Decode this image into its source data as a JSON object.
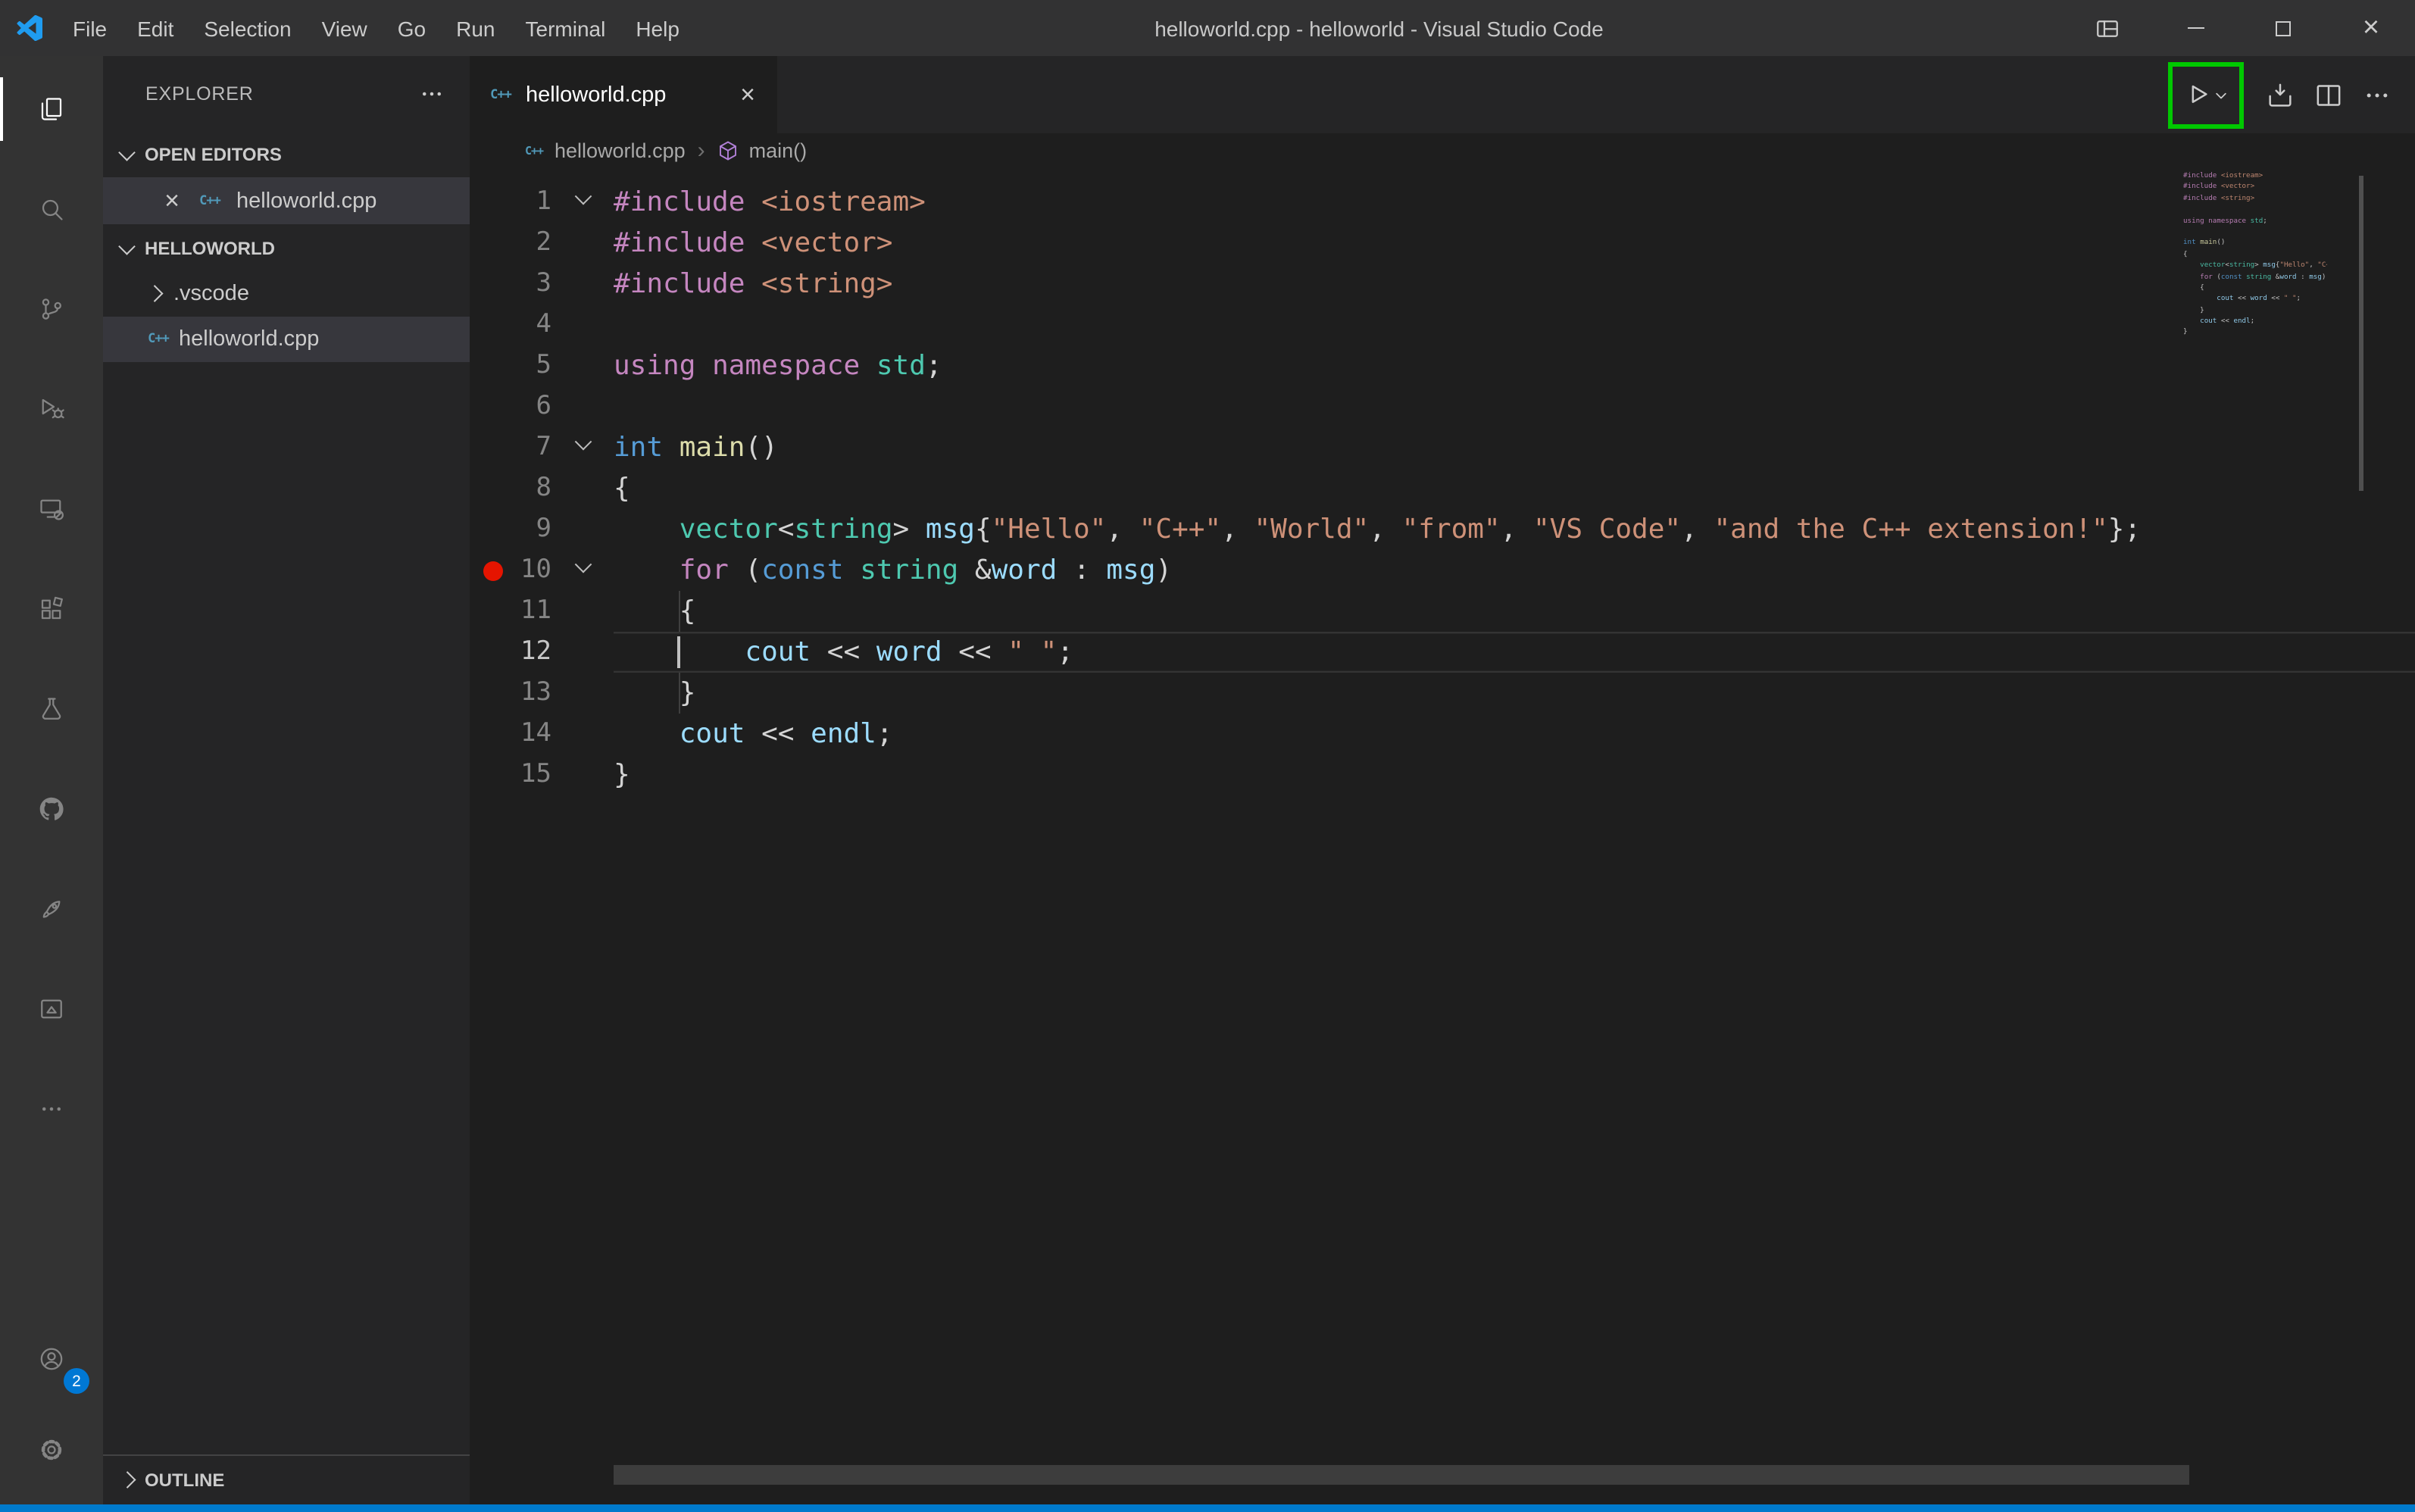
{
  "window": {
    "title": "helloworld.cpp - helloworld - Visual Studio Code",
    "menus": [
      "File",
      "Edit",
      "Selection",
      "View",
      "Go",
      "Run",
      "Terminal",
      "Help"
    ],
    "controls": [
      "layout",
      "minimize",
      "maximize",
      "close"
    ]
  },
  "activity_bar": {
    "top": [
      {
        "icon": "explorer",
        "active": true
      },
      {
        "icon": "search"
      },
      {
        "icon": "source-control"
      },
      {
        "icon": "run-and-debug"
      },
      {
        "icon": "remote-explorer"
      },
      {
        "icon": "extensions"
      },
      {
        "icon": "testing"
      },
      {
        "icon": "github"
      },
      {
        "icon": "rocket"
      },
      {
        "icon": "live-preview"
      },
      {
        "icon": "more"
      }
    ],
    "bottom": [
      {
        "icon": "accounts",
        "badge": "2"
      },
      {
        "icon": "settings"
      }
    ]
  },
  "explorer": {
    "title": "EXPLORER",
    "open_editors": {
      "label": "OPEN EDITORS",
      "items": [
        {
          "name": "helloworld.cpp",
          "icon": "cpp",
          "active": true
        }
      ]
    },
    "workspace": {
      "label": "HELLOWORLD",
      "items": [
        {
          "name": ".vscode",
          "type": "folder"
        },
        {
          "name": "helloworld.cpp",
          "type": "file",
          "icon": "cpp",
          "selected": true
        }
      ]
    },
    "outline": {
      "label": "OUTLINE"
    }
  },
  "editor": {
    "tab": {
      "label": "helloworld.cpp",
      "icon": "cpp"
    },
    "breadcrumbs": {
      "file": "helloworld.cpp",
      "symbol": "main()"
    },
    "code": {
      "language": "cpp",
      "breakpoint_line": 10,
      "current_line": 12,
      "lines": [
        {
          "n": 1,
          "fold": true,
          "t": [
            [
              "kw",
              "#include"
            ],
            [
              "pl",
              " "
            ],
            [
              "str",
              "<iostream>"
            ]
          ]
        },
        {
          "n": 2,
          "t": [
            [
              "kw",
              "#include"
            ],
            [
              "pl",
              " "
            ],
            [
              "str",
              "<vector>"
            ]
          ]
        },
        {
          "n": 3,
          "t": [
            [
              "kw",
              "#include"
            ],
            [
              "pl",
              " "
            ],
            [
              "str",
              "<string>"
            ]
          ]
        },
        {
          "n": 4,
          "t": []
        },
        {
          "n": 5,
          "t": [
            [
              "kw",
              "using"
            ],
            [
              "pl",
              " "
            ],
            [
              "kw",
              "namespace"
            ],
            [
              "pl",
              " "
            ],
            [
              "type",
              "std"
            ],
            [
              "pl",
              ";"
            ]
          ]
        },
        {
          "n": 6,
          "t": []
        },
        {
          "n": 7,
          "fold": true,
          "t": [
            [
              "kw2",
              "int"
            ],
            [
              "pl",
              " "
            ],
            [
              "fn",
              "main"
            ],
            [
              "pl",
              "()"
            ]
          ]
        },
        {
          "n": 8,
          "t": [
            [
              "pl",
              "{"
            ]
          ]
        },
        {
          "n": 9,
          "t": [
            [
              "pl",
              "    "
            ],
            [
              "type",
              "vector"
            ],
            [
              "pl",
              "<"
            ],
            [
              "type",
              "string"
            ],
            [
              "pl",
              "> "
            ],
            [
              "var",
              "msg"
            ],
            [
              "pl",
              "{"
            ],
            [
              "str",
              "\"Hello\""
            ],
            [
              "pl",
              ", "
            ],
            [
              "str",
              "\"C++\""
            ],
            [
              "pl",
              ", "
            ],
            [
              "str",
              "\"World\""
            ],
            [
              "pl",
              ", "
            ],
            [
              "str",
              "\"from\""
            ],
            [
              "pl",
              ", "
            ],
            [
              "str",
              "\"VS Code\""
            ],
            [
              "pl",
              ", "
            ],
            [
              "str",
              "\"and the C++ extension!\""
            ],
            [
              "pl",
              "};"
            ]
          ]
        },
        {
          "n": 10,
          "fold": true,
          "bp": true,
          "t": [
            [
              "pl",
              "    "
            ],
            [
              "kw",
              "for"
            ],
            [
              "pl",
              " ("
            ],
            [
              "kw2",
              "const"
            ],
            [
              "pl",
              " "
            ],
            [
              "type",
              "string"
            ],
            [
              "pl",
              " &"
            ],
            [
              "var",
              "word"
            ],
            [
              "pl",
              " : "
            ],
            [
              "var",
              "msg"
            ],
            [
              "pl",
              ")"
            ]
          ]
        },
        {
          "n": 11,
          "g": true,
          "t": [
            [
              "pl",
              "    {"
            ]
          ]
        },
        {
          "n": 12,
          "cur": true,
          "cursor": true,
          "t": [
            [
              "pl",
              "        "
            ],
            [
              "var",
              "cout"
            ],
            [
              "pl",
              " << "
            ],
            [
              "var",
              "word"
            ],
            [
              "pl",
              " << "
            ],
            [
              "str",
              "\" \""
            ],
            [
              "pl",
              ";"
            ]
          ]
        },
        {
          "n": 13,
          "g": true,
          "t": [
            [
              "pl",
              "    }"
            ]
          ]
        },
        {
          "n": 14,
          "t": [
            [
              "pl",
              "    "
            ],
            [
              "var",
              "cout"
            ],
            [
              "pl",
              " << "
            ],
            [
              "var",
              "endl"
            ],
            [
              "pl",
              ";"
            ]
          ]
        },
        {
          "n": 15,
          "t": [
            [
              "pl",
              "}"
            ]
          ]
        }
      ]
    }
  },
  "colors": {
    "accent_blue": "#007ACC",
    "annotation_green": "#00C800",
    "breakpoint_red": "#E51400",
    "badge_blue": "#0078D4",
    "token_kw": "#C586C0",
    "token_kw2": "#569CD6",
    "token_type": "#4EC9B0",
    "token_fn": "#DCDCAA",
    "token_var": "#9CDCFE",
    "token_str": "#CE9178",
    "token_pl": "#D4D4D4"
  }
}
